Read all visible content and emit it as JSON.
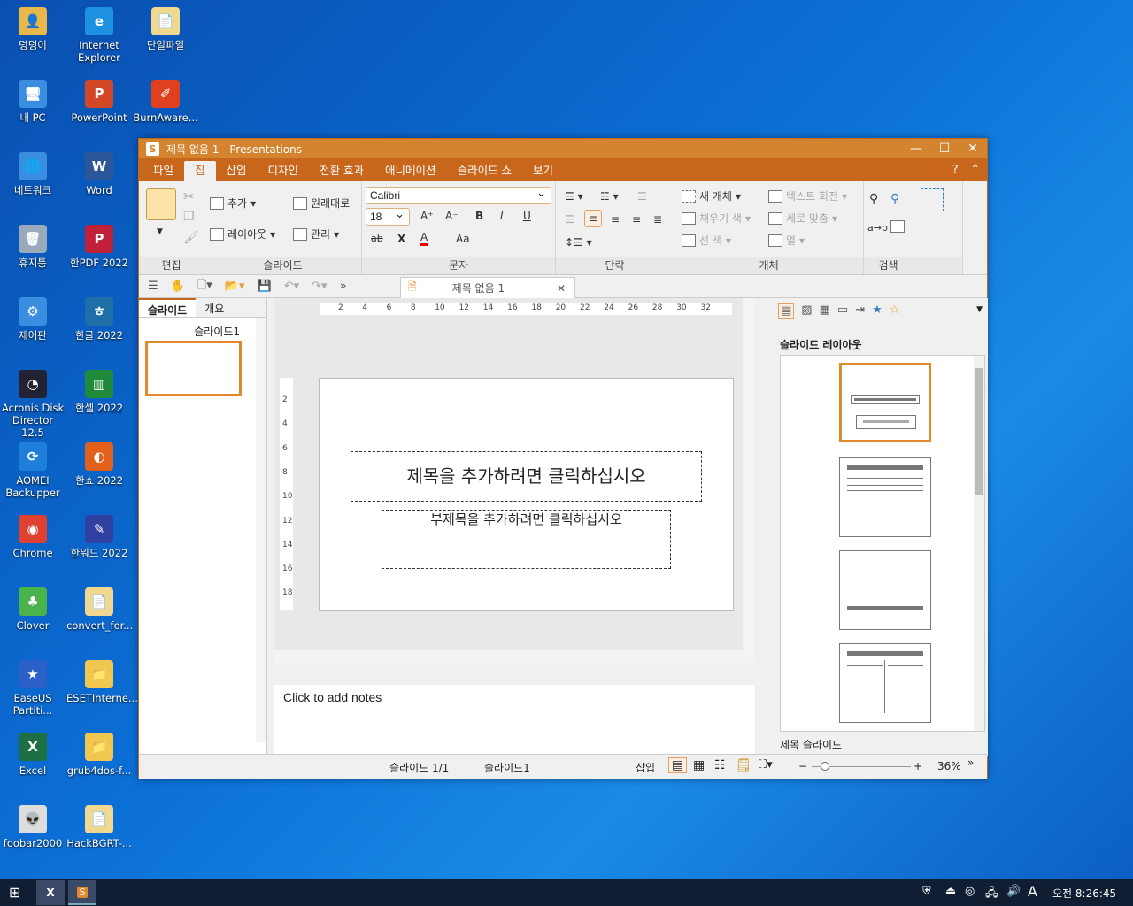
{
  "desktop": {
    "icons": [
      {
        "label": "덩덩이",
        "color": "#e8b84a",
        "glyph": "👤"
      },
      {
        "label": "내 PC",
        "color": "#3a8ee0",
        "glyph": "🖥"
      },
      {
        "label": "네트워크",
        "color": "#3a8ee0",
        "glyph": "🌐"
      },
      {
        "label": "휴지통",
        "color": "#9ab",
        "glyph": "🗑"
      },
      {
        "label": "제어판",
        "color": "#3a8ee0",
        "glyph": "⚙"
      },
      {
        "label": "Acronis Disk Director 12.5",
        "color": "#223",
        "glyph": "◔"
      },
      {
        "label": "AOMEI Backupper",
        "color": "#1e7fd8",
        "glyph": "⟳"
      },
      {
        "label": "Chrome",
        "color": "#e04030",
        "glyph": "◉"
      },
      {
        "label": "Clover",
        "color": "#4bb34b",
        "glyph": "♣"
      },
      {
        "label": "EaseUS Partiti...",
        "color": "#2a60c8",
        "glyph": "★"
      },
      {
        "label": "Excel",
        "color": "#1d7044",
        "glyph": "X"
      },
      {
        "label": "foobar2000",
        "color": "#ddd",
        "glyph": "👽"
      },
      {
        "label": "Internet Explorer",
        "color": "#1e90e0",
        "glyph": "e"
      },
      {
        "label": "PowerPoint",
        "color": "#d24726",
        "glyph": "P"
      },
      {
        "label": "Word",
        "color": "#2b579a",
        "glyph": "W"
      },
      {
        "label": "한PDF 2022",
        "color": "#c0203a",
        "glyph": "P"
      },
      {
        "label": "한글 2022",
        "color": "#1e6fa8",
        "glyph": "ㅎ"
      },
      {
        "label": "한셀 2022",
        "color": "#1e8a3a",
        "glyph": "▥"
      },
      {
        "label": "한쇼 2022",
        "color": "#e0601c",
        "glyph": "◐"
      },
      {
        "label": "한워드 2022",
        "color": "#3040a0",
        "glyph": "✎"
      },
      {
        "label": "convert_for...",
        "color": "#f0d890",
        "glyph": "📄"
      },
      {
        "label": "ESETInterne...",
        "color": "#f0c850",
        "glyph": "📁"
      },
      {
        "label": "grub4dos-f...",
        "color": "#f0c850",
        "glyph": "📁"
      },
      {
        "label": "HackBGRT-...",
        "color": "#f0d890",
        "glyph": "📄"
      },
      {
        "label": "단일파일",
        "color": "#f0d890",
        "glyph": "📄"
      },
      {
        "label": "BurnAware...",
        "color": "#e04020",
        "glyph": "✐"
      }
    ]
  },
  "window": {
    "title": "제목 없음 1 - Presentations",
    "controls": [
      "—",
      "☐",
      "✕"
    ],
    "menu": [
      "파일",
      "집",
      "삽입",
      "디자인",
      "전환 효과",
      "애니메이션",
      "슬라이드 쇼",
      "보기"
    ],
    "active_menu": "집",
    "help": "?",
    "collapse": "⌃"
  },
  "ribbon": {
    "edit": {
      "label": "편집"
    },
    "slide": {
      "label": "슬라이드",
      "add": "추가",
      "reset": "원래대로",
      "layout": "레이아웃",
      "manage": "관리"
    },
    "text": {
      "label": "문자",
      "font": "Calibri",
      "size": "18",
      "bold": "B",
      "italic": "I",
      "underline": "U",
      "strike": "ab",
      "clear": "X",
      "color": "A",
      "case": "Aa",
      "grow": "A⁺",
      "shrink": "A⁻"
    },
    "paragraph": {
      "label": "단락"
    },
    "object": {
      "label": "개체",
      "new": "새 개체",
      "fill": "채우기 색",
      "line": "선 색",
      "rotate": "텍스트 회전",
      "valign": "세로 맞춤",
      "columns": "열"
    },
    "search": {
      "label": "검색",
      "replace": "a→b"
    }
  },
  "doc_tab": {
    "title": "제목 없음 1"
  },
  "left_panel": {
    "tabs": [
      "슬라이드",
      "개요"
    ],
    "slide_label": "슬라이드1"
  },
  "ruler": {
    "h": [
      "2",
      "4",
      "6",
      "8",
      "10",
      "12",
      "14",
      "16",
      "18",
      "20",
      "22",
      "24",
      "26",
      "28",
      "30",
      "32"
    ],
    "v": [
      "2",
      "4",
      "6",
      "8",
      "10",
      "12",
      "14",
      "16",
      "18"
    ]
  },
  "slide": {
    "title_placeholder": "제목을 추가하려면 클릭하십시오",
    "subtitle_placeholder": "부제목을 추가하려면 클릭하십시오"
  },
  "notes": {
    "placeholder": "Click to add notes"
  },
  "right_panel": {
    "heading": "슬라이드 레이아웃",
    "footer": "제목 슬라이드"
  },
  "status": {
    "slide_count": "슬라이드 1/1",
    "slide_name": "슬라이드1",
    "mode": "삽입",
    "zoom": "36%",
    "zoom_value": 36
  },
  "taskbar": {
    "time": "오전 8:26:45",
    "ime": "A"
  }
}
